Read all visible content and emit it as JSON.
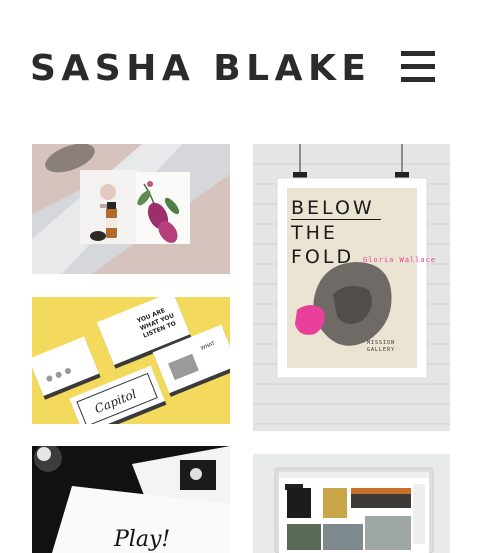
{
  "header": {
    "site_title": "SASHA BLAKE",
    "menu_icon": "hamburger-menu-icon"
  },
  "portfolio": {
    "tiles": [
      {
        "subject": "botanical-stationery"
      },
      {
        "subject": "business-cards"
      },
      {
        "subject": "below-the-fold-poster"
      },
      {
        "subject": "black-white-print"
      },
      {
        "subject": "website-mockup"
      }
    ],
    "poster": {
      "headline_line1": "BELOW",
      "headline_line2": "THE",
      "headline_line3": "FOLD",
      "artist": "Gloria Wallace",
      "venue_line1": "MISSION",
      "venue_line2": "GALLERY"
    },
    "cards": {
      "card_text_1": "YOU ARE WHAT YOU LISTEN TO",
      "logo_text": "Capitol"
    },
    "print_text": "Play!"
  },
  "colors": {
    "title": "#2b2b2b",
    "accent_pink": "#e8409a",
    "accent_yellow": "#f4da5c"
  }
}
